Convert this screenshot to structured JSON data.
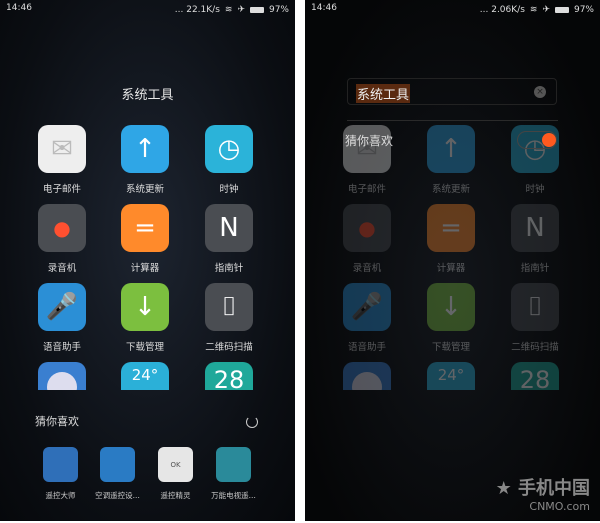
{
  "left": {
    "status": {
      "time": "14:46",
      "speed": "... 22.1K/s",
      "battery": "97%"
    },
    "folder_title": "系统工具",
    "apps": [
      {
        "label": "电子邮件",
        "icon": "mail-icon",
        "color": "#eeeeee"
      },
      {
        "label": "系统更新",
        "icon": "arrow-up-icon",
        "color": "#2fa6e6"
      },
      {
        "label": "时钟",
        "icon": "clock-icon",
        "color": "#2bb3d9"
      },
      {
        "label": "录音机",
        "icon": "record-icon",
        "color": "#4a4d52"
      },
      {
        "label": "计算器",
        "icon": "calculator-icon",
        "color": "#ff8a2b"
      },
      {
        "label": "指南针",
        "icon": "compass-icon",
        "color": "#4a4d52"
      },
      {
        "label": "语音助手",
        "icon": "microphone-icon",
        "color": "#2b8fd6"
      },
      {
        "label": "下载管理",
        "icon": "download-icon",
        "color": "#7cbf3f"
      },
      {
        "label": "二维码扫描",
        "icon": "scanner-icon",
        "color": "#4a4d52"
      }
    ],
    "partial_apps": [
      {
        "icon": "remote-icon",
        "color": "#3a7fd0"
      },
      {
        "icon": "weather-icon",
        "color": "#2bb0d8",
        "text": "24°"
      },
      {
        "icon": "calendar-icon",
        "color": "#1fa89a",
        "text": "28"
      }
    ],
    "recommend_title": "猜你喜欢",
    "recommend": [
      {
        "label": "遥控大师",
        "icon": "remote-master-icon",
        "color": "#2f6fb8"
      },
      {
        "label": "空调遥控设...",
        "icon": "ac-remote-icon",
        "color": "#2a7bc4"
      },
      {
        "label": "遥控精灵",
        "icon": "remote-sprite-icon",
        "color": "#e6e6e6",
        "text": "OK"
      },
      {
        "label": "万能电视遥...",
        "icon": "tv-remote-icon",
        "color": "#2a8a9a"
      }
    ]
  },
  "right": {
    "status": {
      "time": "14:46",
      "speed": "... 2.06K/s",
      "battery": "97%"
    },
    "search_value": "系统工具",
    "recommend_label": "猜你喜欢",
    "recommend_toggle_on": true,
    "watermark": {
      "cn": "手机中国",
      "en": "CNMO.com"
    }
  }
}
